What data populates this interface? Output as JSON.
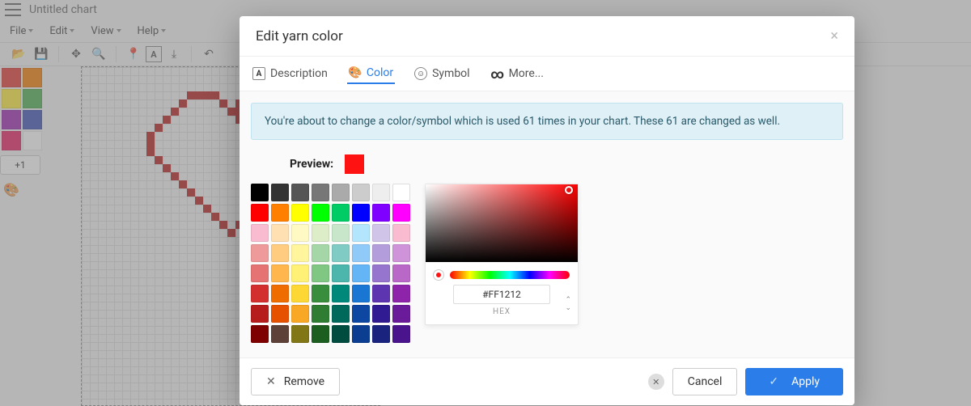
{
  "app": {
    "title": "Untitled chart"
  },
  "menus": {
    "file": "File",
    "edit": "Edit",
    "view": "View",
    "help": "Help"
  },
  "sidebar": {
    "mini_palette": [
      "#E53935",
      "#F57C00",
      "#FFEB3B",
      "#4CAF50",
      "#9C27B0",
      "#3F51B5",
      "#E91E63",
      "#FFFFFF"
    ],
    "plus_label": "+1"
  },
  "modal": {
    "title": "Edit yarn color",
    "tabs": {
      "description": "Description",
      "color": "Color",
      "symbol": "Symbol",
      "more": "More..."
    },
    "banner": "You're about to change a color/symbol which is used 61 times in your chart. These 61 are changed as well.",
    "preview_label": "Preview:",
    "preview_color": "#FF1212",
    "hex_value": "#FF1212",
    "hex_label": "HEX",
    "swatches": [
      "#000000",
      "#333333",
      "#555555",
      "#777777",
      "#AAAAAA",
      "#CCCCCC",
      "#EEEEEE",
      "#FFFFFF",
      "#FF0000",
      "#FF8000",
      "#FFFF00",
      "#00FF00",
      "#00CC66",
      "#0000FF",
      "#8000FF",
      "#FF00FF",
      "#F8BBD0",
      "#FFE0B2",
      "#FFF9C4",
      "#DCEDC8",
      "#C8E6C9",
      "#B3E5FC",
      "#D1C4E9",
      "#F8BBD0",
      "#EF9A9A",
      "#FFCC80",
      "#FFF59D",
      "#A5D6A7",
      "#80CBC4",
      "#90CAF9",
      "#B39DDB",
      "#CE93D8",
      "#E57373",
      "#FFB74D",
      "#FFF176",
      "#81C784",
      "#4DB6AC",
      "#64B5F6",
      "#9575CD",
      "#BA68C8",
      "#D32F2F",
      "#EF6C00",
      "#FDD835",
      "#388E3C",
      "#00897B",
      "#1976D2",
      "#5E35B1",
      "#8E24AA",
      "#B71C1C",
      "#E65100",
      "#F9A825",
      "#2E7D32",
      "#00695C",
      "#0D47A1",
      "#311B92",
      "#6A1B9A",
      "#7F0000",
      "#5D4037",
      "#827717",
      "#1B5E20",
      "#004D40",
      "#0B3D91",
      "#1A237E",
      "#4A148C"
    ],
    "footer": {
      "remove": "Remove",
      "cancel": "Cancel",
      "apply": "Apply"
    }
  }
}
